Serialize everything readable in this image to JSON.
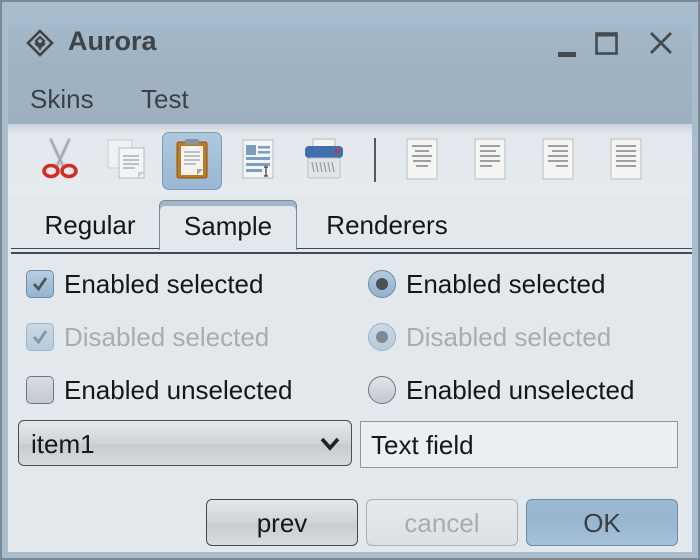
{
  "window": {
    "title": "Aurora",
    "app_icon": "aurora-diamond-icon",
    "controls": [
      "minimize-icon",
      "maximize-icon",
      "close-icon"
    ]
  },
  "menubar": {
    "items": [
      {
        "label": "Skins"
      },
      {
        "label": "Test"
      }
    ]
  },
  "toolbar": {
    "buttons": [
      {
        "icon": "cut-icon",
        "active": false
      },
      {
        "icon": "copy-icon",
        "active": false
      },
      {
        "icon": "paste-icon",
        "active": true
      },
      {
        "icon": "select-all-icon",
        "active": false
      },
      {
        "icon": "delete-shredder-icon",
        "active": false
      },
      {
        "icon": "align-center-icon",
        "active": false
      },
      {
        "icon": "align-left-icon",
        "active": false
      },
      {
        "icon": "align-right-icon",
        "active": false
      },
      {
        "icon": "align-justify-icon",
        "active": false
      }
    ]
  },
  "tabs": {
    "items": [
      {
        "label": "Regular",
        "selected": false
      },
      {
        "label": "Sample",
        "selected": true
      },
      {
        "label": "Renderers",
        "selected": false
      }
    ]
  },
  "sample": {
    "checkboxes": [
      {
        "label": "Enabled selected",
        "checked": true,
        "enabled": true
      },
      {
        "label": "Disabled selected",
        "checked": true,
        "enabled": false
      },
      {
        "label": "Enabled unselected",
        "checked": false,
        "enabled": true
      }
    ],
    "radios": [
      {
        "label": "Enabled selected",
        "checked": true,
        "enabled": true
      },
      {
        "label": "Disabled selected",
        "checked": true,
        "enabled": false
      },
      {
        "label": "Enabled unselected",
        "checked": false,
        "enabled": true
      }
    ],
    "combo": {
      "value": "item1"
    },
    "text_field": {
      "value": "Text field"
    }
  },
  "buttons": {
    "prev": "prev",
    "cancel": "cancel",
    "ok": "OK"
  },
  "colors": {
    "title_bar": "#a5b9ca",
    "selection_accent": "#9ab6cf",
    "panel_bg": "#e3e8ed"
  }
}
